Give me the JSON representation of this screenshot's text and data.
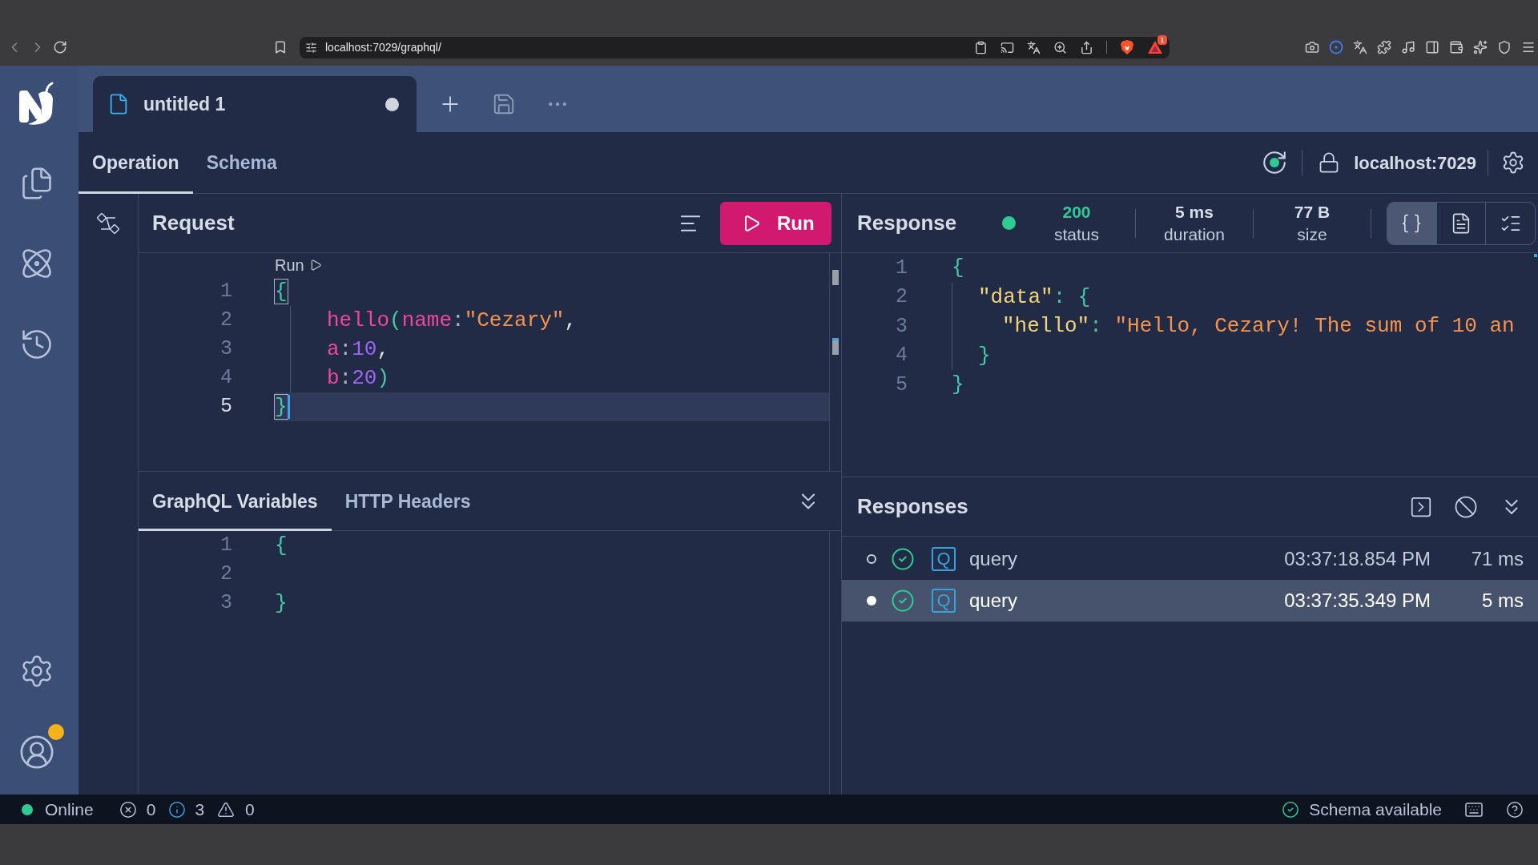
{
  "browser": {
    "url": "localhost:7029/graphql/",
    "rewards_badge": "1"
  },
  "sidebar": {
    "account_notification": true
  },
  "document_tabs": [
    {
      "label": "untitled 1",
      "selected": true,
      "unsaved": true
    }
  ],
  "view_tabs": [
    {
      "label": "Operation",
      "selected": true
    },
    {
      "label": "Schema",
      "selected": false
    }
  ],
  "connection": {
    "status_ok": true,
    "endpoint": "localhost:7029"
  },
  "request": {
    "title": "Request",
    "run_button": "Run",
    "codelens": "Run",
    "lines": [
      {
        "number": "1",
        "active": false,
        "tokens": [
          {
            "text": "{",
            "kind": "brace_match"
          }
        ],
        "children": [
          {
            "number": "2",
            "active": false,
            "tokens": [
              {
                "text": "hello",
                "kind": "field"
              },
              {
                "text": "(",
                "kind": "paren"
              },
              {
                "text": "name",
                "kind": "argument"
              },
              {
                "text": ":",
                "kind": "colon"
              },
              {
                "text": "\"Cezary\"",
                "kind": "string"
              },
              {
                "text": ",",
                "kind": "comma"
              }
            ]
          },
          {
            "number": "3",
            "active": false,
            "tokens": [
              {
                "text": "a",
                "kind": "argument"
              },
              {
                "text": ":",
                "kind": "colon"
              },
              {
                "text": "10",
                "kind": "number"
              },
              {
                "text": ",",
                "kind": "comma"
              }
            ]
          },
          {
            "number": "4",
            "active": false,
            "tokens": [
              {
                "text": "b",
                "kind": "argument"
              },
              {
                "text": ":",
                "kind": "colon"
              },
              {
                "text": "20",
                "kind": "number"
              },
              {
                "text": ")",
                "kind": "paren"
              }
            ]
          }
        ]
      },
      {
        "number": "5",
        "active": true,
        "tokens": [
          {
            "text": "}",
            "kind": "brace_match"
          }
        ]
      }
    ],
    "bottom_tabs": [
      {
        "label": "GraphQL Variables",
        "selected": true
      },
      {
        "label": "HTTP Headers",
        "selected": false
      }
    ],
    "variables": [
      {
        "number": "1",
        "tokens": [
          {
            "text": "{",
            "kind": "brace"
          }
        ]
      },
      {
        "number": "2"
      },
      {
        "number": "3",
        "tokens": [
          {
            "text": "}",
            "kind": "brace"
          }
        ]
      }
    ]
  },
  "response": {
    "title": "Response",
    "ok": true,
    "stats": [
      {
        "value": "200",
        "label": "status",
        "kind": "status"
      },
      {
        "value": "5 ms",
        "label": "duration",
        "kind": "metric"
      },
      {
        "value": "77 B",
        "label": "size",
        "kind": "metric"
      }
    ],
    "view_modes": [
      {
        "kind": "json",
        "selected": true
      },
      {
        "kind": "document",
        "selected": false
      },
      {
        "kind": "checklist",
        "selected": false
      }
    ],
    "lines": [
      {
        "number": "1",
        "tokens": [
          {
            "text": "{",
            "kind": "brace"
          }
        ],
        "children": [
          {
            "number": "2",
            "tokens": [
              {
                "text": "\"data\"",
                "kind": "key"
              },
              {
                "text": ": ",
                "kind": "colon"
              },
              {
                "text": "{",
                "kind": "brace"
              }
            ],
            "children": [
              {
                "number": "3",
                "tokens": [
                  {
                    "text": "\"hello\"",
                    "kind": "key"
                  },
                  {
                    "text": ": ",
                    "kind": "colon"
                  },
                  {
                    "text": "\"Hello, Cezary! The sum of 10 an",
                    "kind": "string"
                  }
                ]
              }
            ]
          },
          {
            "number": "4",
            "tokens": [
              {
                "text": "}",
                "kind": "brace"
              }
            ]
          }
        ]
      },
      {
        "number": "5",
        "tokens": [
          {
            "text": "}",
            "kind": "brace"
          }
        ]
      }
    ]
  },
  "responses": {
    "title": "Responses",
    "items": [
      {
        "selected": false,
        "success": true,
        "badge": "Q",
        "operation": "query",
        "time": "03:37:18.854 PM",
        "duration": "71 ms"
      },
      {
        "selected": true,
        "success": true,
        "badge": "Q",
        "operation": "query",
        "time": "03:37:35.349 PM",
        "duration": "5 ms"
      }
    ]
  },
  "status_bar": {
    "online": true,
    "connection": "Online",
    "errors": "0",
    "infos": "3",
    "warnings": "0",
    "schema": "Schema available"
  }
}
